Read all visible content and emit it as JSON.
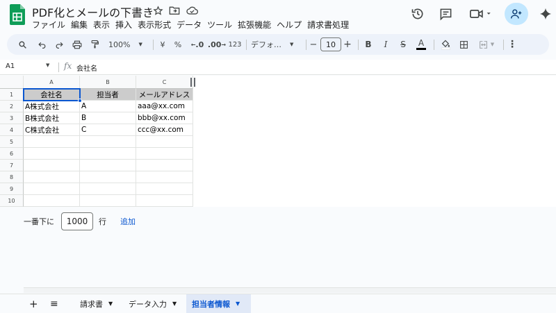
{
  "colors": {
    "brand_green": "#0f9d58",
    "accent_blue": "#0b57d0",
    "header_fill": "#cccccc",
    "share_bg": "#c2e7ff"
  },
  "header": {
    "title": "PDF化とメールの下書き",
    "icons": [
      "star-icon",
      "move-to-folder-icon",
      "cloud-status-icon",
      "history-icon",
      "comments-icon",
      "meet-icon",
      "share-icon",
      "gemini-icon"
    ]
  },
  "menu": [
    "ファイル",
    "編集",
    "表示",
    "挿入",
    "表示形式",
    "データ",
    "ツール",
    "拡張機能",
    "ヘルプ",
    "請求書処理"
  ],
  "toolbar": {
    "zoom": "100%",
    "currency": "¥",
    "percent": "%",
    "dec_minus": ".0",
    "dec_plus": ".00",
    "number_format": "123",
    "font": "デフォ…",
    "minus": "−",
    "font_size": "10",
    "plus": "+",
    "bold": "B",
    "italic": "I",
    "strike": "S",
    "textcolor": "A"
  },
  "formula_bar": {
    "cell_ref": "A1",
    "fx": "fx",
    "content": "会社名"
  },
  "grid": {
    "columns": [
      "A",
      "B",
      "C"
    ],
    "rows": [
      "1",
      "2",
      "3",
      "4",
      "5",
      "6",
      "7",
      "8",
      "9",
      "10"
    ],
    "cells": [
      [
        "会社名",
        "担当者",
        "メールアドレス"
      ],
      [
        "A株式会社",
        "A",
        "aaa@xx.com"
      ],
      [
        "B株式会社",
        "B",
        "bbb@xx.com"
      ],
      [
        "C株式会社",
        "C",
        "ccc@xx.com"
      ]
    ]
  },
  "add_rows": {
    "prefix": "一番下に",
    "count": "1000",
    "unit": "行",
    "button": "追加"
  },
  "sheets": {
    "add": "+",
    "list": "≡",
    "tabs": [
      "請求書",
      "データ入力",
      "担当者情報"
    ],
    "active_index": 2
  }
}
